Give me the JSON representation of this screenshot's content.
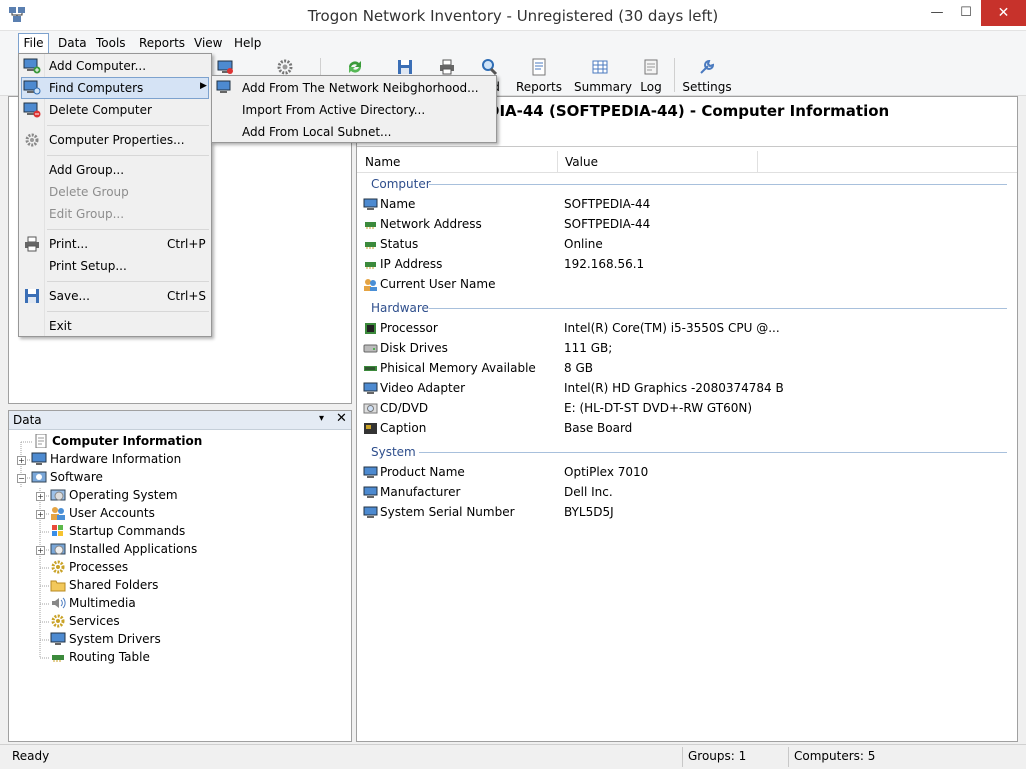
{
  "window": {
    "title": "Trogon Network Inventory - Unregistered (30 days left)",
    "minimize": "—",
    "maximize": "☐",
    "close": "✕"
  },
  "menubar": [
    "File",
    "Data",
    "Tools",
    "Reports",
    "View",
    "Help"
  ],
  "toolbar": [
    {
      "label": "",
      "icon": "add-computer-icon"
    },
    {
      "label": "",
      "icon": "gear-icon"
    },
    {
      "label": "",
      "icon": "refresh-icon"
    },
    {
      "label": "",
      "icon": "save-icon"
    },
    {
      "label": "",
      "icon": "print-icon"
    },
    {
      "label": "d",
      "icon": "find-icon"
    },
    {
      "label": "Reports",
      "icon": "reports-icon"
    },
    {
      "label": "Summary",
      "icon": "summary-icon"
    },
    {
      "label": "Log",
      "icon": "log-icon"
    },
    {
      "label": "Settings",
      "icon": "settings-icon"
    }
  ],
  "file_menu": {
    "items": [
      {
        "label": "Add Computer...",
        "shortcut": "",
        "disabled": false,
        "icon": "add-computer-icon"
      },
      {
        "label": "Find Computers",
        "shortcut": "",
        "disabled": false,
        "icon": "find-computers-icon",
        "arrow": "▶"
      },
      {
        "label": "Delete Computer",
        "shortcut": "",
        "disabled": false,
        "icon": "delete-computer-icon"
      },
      {
        "label": "Computer Properties...",
        "shortcut": "",
        "disabled": false,
        "icon": "properties-icon"
      },
      {
        "label": "Add Group...",
        "shortcut": "",
        "disabled": false,
        "icon": ""
      },
      {
        "label": "Delete Group",
        "shortcut": "",
        "disabled": true,
        "icon": ""
      },
      {
        "label": "Edit Group...",
        "shortcut": "",
        "disabled": true,
        "icon": ""
      },
      {
        "label": "Print...",
        "shortcut": "Ctrl+P",
        "disabled": false,
        "icon": "print-icon"
      },
      {
        "label": "Print Setup...",
        "shortcut": "",
        "disabled": false,
        "icon": ""
      },
      {
        "label": "Save...",
        "shortcut": "Ctrl+S",
        "disabled": false,
        "icon": "save-icon"
      },
      {
        "label": "Exit",
        "shortcut": "",
        "disabled": false,
        "icon": ""
      }
    ]
  },
  "submenu": [
    "Add From The Network Neibghorhood...",
    "Import From Active Directory...",
    "Add From Local Subnet..."
  ],
  "data_panel": {
    "title": "Data",
    "pin": "▾",
    "close": "✕",
    "tree": [
      {
        "label": "Computer Information",
        "bold": true,
        "icon": "document-icon",
        "expander": ""
      },
      {
        "label": "Hardware Information",
        "icon": "monitor-icon",
        "expander": "+"
      },
      {
        "label": "Software",
        "icon": "software-icon",
        "expander": "−"
      },
      {
        "label": "Operating System",
        "icon": "os-icon",
        "expander": "+"
      },
      {
        "label": "User Accounts",
        "icon": "users-icon",
        "expander": "+"
      },
      {
        "label": "Startup Commands",
        "icon": "windows-icon",
        "expander": ""
      },
      {
        "label": "Installed Applications",
        "icon": "apps-icon",
        "expander": "+"
      },
      {
        "label": "Processes",
        "icon": "gear-icon",
        "expander": ""
      },
      {
        "label": "Shared Folders",
        "icon": "folder-icon",
        "expander": ""
      },
      {
        "label": "Multimedia",
        "icon": "speaker-icon",
        "expander": ""
      },
      {
        "label": "Services",
        "icon": "gear-icon",
        "expander": ""
      },
      {
        "label": "System Drivers",
        "icon": "monitor-icon",
        "expander": ""
      },
      {
        "label": "Routing Table",
        "icon": "network-card-icon",
        "expander": ""
      }
    ]
  },
  "main": {
    "title": "DIA-44 (SOFTPEDIA-44) - Computer Information",
    "columns": [
      "Name",
      "Value"
    ],
    "groups": [
      {
        "name": "Computer",
        "rows": [
          {
            "name": "Name",
            "value": "SOFTPEDIA-44",
            "icon": "computer-icon"
          },
          {
            "name": "Network Address",
            "value": "SOFTPEDIA-44",
            "icon": "network-card-icon"
          },
          {
            "name": "Status",
            "value": "Online",
            "icon": "network-card-icon"
          },
          {
            "name": "IP Address",
            "value": "192.168.56.1",
            "icon": "network-card-icon"
          },
          {
            "name": "Current User Name",
            "value": "",
            "icon": "users-icon"
          }
        ]
      },
      {
        "name": "Hardware",
        "rows": [
          {
            "name": "Processor",
            "value": "Intel(R) Core(TM) i5-3550S CPU @...",
            "icon": "chip-icon"
          },
          {
            "name": "Disk Drives",
            "value": "111 GB;",
            "icon": "disk-icon"
          },
          {
            "name": "Phisical Memory Available",
            "value": "8 GB",
            "icon": "memory-icon"
          },
          {
            "name": "Video Adapter",
            "value": "Intel(R) HD Graphics -2080374784 B",
            "icon": "monitor-icon"
          },
          {
            "name": "CD/DVD",
            "value": "E: (HL-DT-ST DVD+-RW GT60N)",
            "icon": "cd-icon"
          },
          {
            "name": "Caption",
            "value": "Base Board",
            "icon": "board-icon"
          }
        ]
      },
      {
        "name": "System",
        "rows": [
          {
            "name": "Product Name",
            "value": "OptiPlex 7010",
            "icon": "computer-icon"
          },
          {
            "name": "Manufacturer",
            "value": "Dell Inc.",
            "icon": "computer-icon"
          },
          {
            "name": "System Serial Number",
            "value": "BYL5D5J",
            "icon": "computer-icon"
          }
        ]
      }
    ]
  },
  "status": {
    "ready": "Ready",
    "groups": "Groups: 1",
    "computers": "Computers: 5"
  },
  "colors": {
    "close_red": "#c7322b",
    "highlight": "#d5e3f5",
    "group_text": "#2e4e8c"
  }
}
